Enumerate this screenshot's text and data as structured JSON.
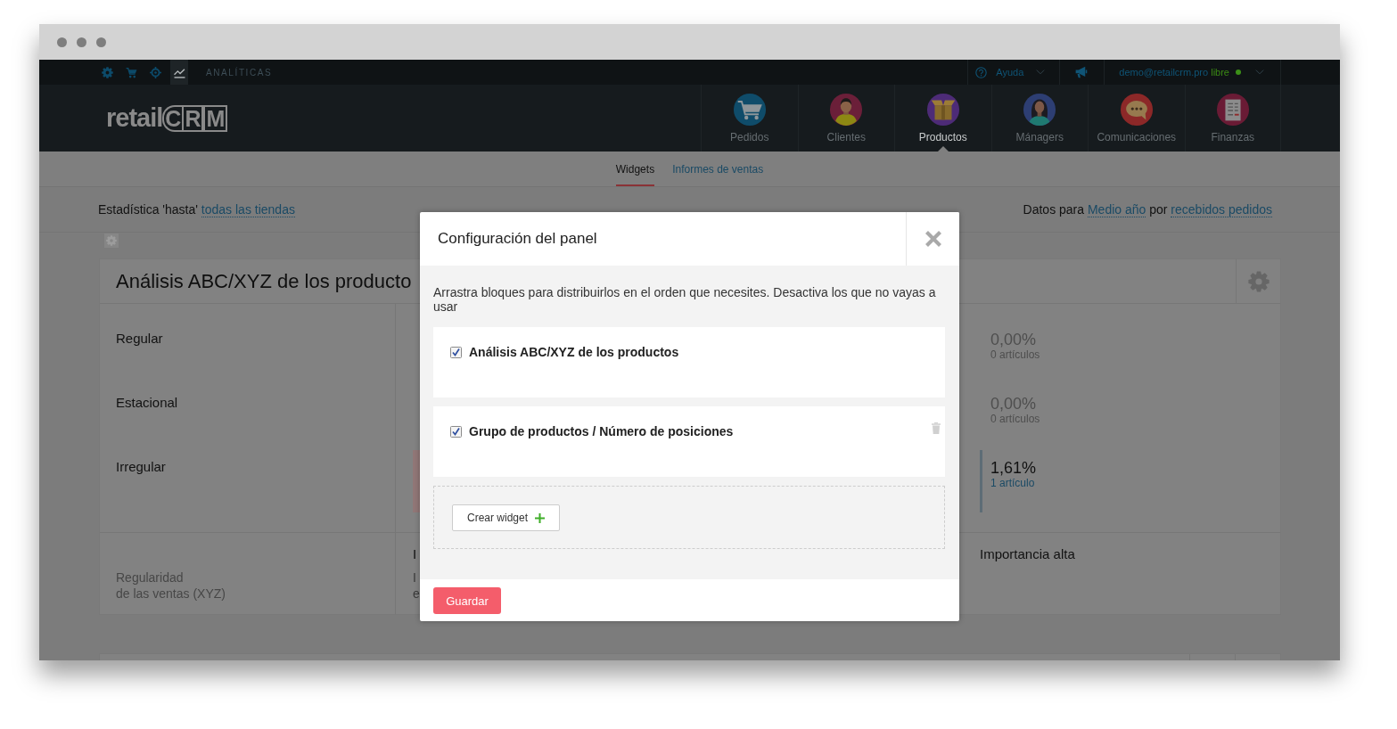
{
  "top_bar": {
    "sections": [
      {
        "kind": "settings",
        "selected": false
      },
      {
        "kind": "cart",
        "selected": false
      },
      {
        "kind": "target",
        "selected": false
      },
      {
        "kind": "chart",
        "selected": true
      }
    ],
    "section_label": "ANALÍTICAS",
    "help": "Ayuda",
    "user": {
      "email": "demo@retailcrm.pro",
      "plan": "libre",
      "online": true
    }
  },
  "logo": {
    "prefix": "retail",
    "boxed": "CRM"
  },
  "main_nav": [
    {
      "label": "Pedidos",
      "kind": "cart",
      "selected": false
    },
    {
      "label": "Clientes",
      "kind": "customer",
      "selected": false
    },
    {
      "label": "Productos",
      "kind": "box",
      "selected": true
    },
    {
      "label": "Mánagers",
      "kind": "manager",
      "selected": false
    },
    {
      "label": "Comunicaciones",
      "kind": "chat",
      "selected": false
    },
    {
      "label": "Finanzas",
      "kind": "invoice",
      "selected": false
    }
  ],
  "sub_tabs": [
    {
      "label": "Widgets",
      "selected": true
    },
    {
      "label": "Informes de ventas",
      "selected": false
    }
  ],
  "filters": {
    "scope": {
      "label": "Estadística 'hasta'",
      "link": "todas las tiendas"
    },
    "period": {
      "label": "Datos para",
      "period_link": "Medio año",
      "connector": "por",
      "metric_link": "recebidos pedidos"
    }
  },
  "widget": {
    "title": "Análisis ABC/XYZ de los producto",
    "rows": [
      {
        "label": "Regular",
        "share": "0,00%",
        "count": "0 artículos",
        "highlighted": false
      },
      {
        "label": "Estacional",
        "share": "0,00%",
        "count": "0 artículos",
        "highlighted": false
      },
      {
        "label": "Irregular",
        "share": "1,61%",
        "count": "1 artículo",
        "highlighted": true
      }
    ],
    "footer": {
      "row_axis": [
        "Regularidad",
        "de las ventas (XYZ)"
      ],
      "column_2_heading": "I",
      "column_2_text": [
        "I",
        "e"
      ],
      "column_3_heading": "Importancia alta"
    }
  },
  "dialog": {
    "title": "Configuración del panel",
    "description": "Arrastra bloques para distribuirlos en el orden que necesites. Desactiva los que no vayas a usar",
    "blocks": [
      {
        "title": "Análisis ABC/XYZ de los productos",
        "checked": true,
        "deletable": false
      },
      {
        "title": "Grupo de productos / Número de posiciones",
        "checked": true,
        "deletable": true
      }
    ],
    "create_button": "Crear widget",
    "save_button": "Guardar"
  }
}
